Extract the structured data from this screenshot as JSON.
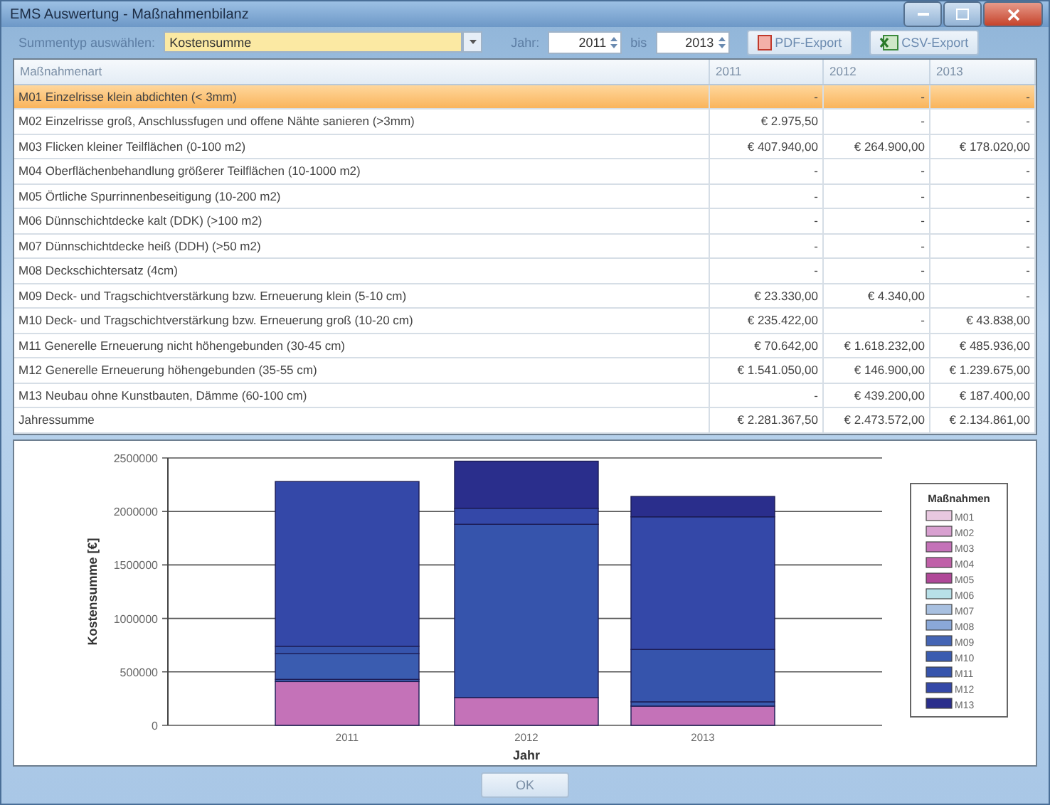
{
  "window": {
    "title": "EMS Auswertung - Maßnahmenbilanz"
  },
  "toolbar": {
    "sum_type_label": "Summentyp auswählen:",
    "sum_type": "Kostensumme",
    "year_label": "Jahr:",
    "year_from": "2011",
    "to_label": "bis",
    "year_to": "2013",
    "buttons": [
      {
        "label": "PDF-Export",
        "kind": "pdf"
      },
      {
        "label": "CSV-Export",
        "kind": "csv"
      }
    ]
  },
  "table": {
    "columns": [
      "Maßnahmenart",
      "2011",
      "2012",
      "2013"
    ],
    "rows": [
      {
        "cells": [
          "M01 Einzelrisse klein abdichten (< 3mm)",
          "-",
          "-",
          "-"
        ],
        "selected": true
      },
      {
        "cells": [
          "M02 Einzelrisse groß, Anschlussfugen und offene Nähte sanieren (>3mm)",
          "€ 2.975,50",
          "-",
          "-"
        ],
        "selected": false
      },
      {
        "cells": [
          "M03 Flicken kleiner Teilflächen (0-100 m2)",
          "€ 407.940,00",
          "€ 264.900,00",
          "€ 178.020,00"
        ],
        "selected": false
      },
      {
        "cells": [
          "M04 Oberflächenbehandlung größerer Teilflächen  (10-1000 m2)",
          "-",
          "-",
          "-"
        ],
        "selected": false
      },
      {
        "cells": [
          "M05 Örtliche Spurrinnenbeseitigung (10-200 m2)",
          "-",
          "-",
          "-"
        ],
        "selected": false
      },
      {
        "cells": [
          "M06 Dünnschichtdecke kalt (DDK) (>100 m2)",
          "-",
          "-",
          "-"
        ],
        "selected": false
      },
      {
        "cells": [
          "M07 Dünnschichtdecke heiß (DDH) (>50 m2)",
          "-",
          "-",
          "-"
        ],
        "selected": false
      },
      {
        "cells": [
          "M08 Deckschichtersatz (4cm)",
          "-",
          "-",
          "-"
        ],
        "selected": false
      },
      {
        "cells": [
          "M09 Deck- und Tragschichtverstärkung bzw. Erneuerung klein (5-10 cm)",
          "€ 23.330,00",
          "€ 4.340,00",
          "-"
        ],
        "selected": false
      },
      {
        "cells": [
          "M10 Deck- und Tragschichtverstärkung bzw. Erneuerung groß (10-20 cm)",
          "€ 235.422,00",
          "-",
          "€ 43.838,00"
        ],
        "selected": false
      },
      {
        "cells": [
          "M11 Generelle Erneuerung nicht höhengebunden (30-45 cm)",
          "€ 70.642,00",
          "€ 1.618.232,00",
          "€ 485.936,00"
        ],
        "selected": false
      },
      {
        "cells": [
          "M12 Generelle Erneuerung höhengebunden (35-55 cm)",
          "€ 1.541.050,00",
          "€ 146.900,00",
          "€ 1.239.675,00"
        ],
        "selected": false
      },
      {
        "cells": [
          "M13 Neubau ohne Kunstbauten, Dämme (60-100 cm)",
          "-",
          "€ 439.200,00",
          "€ 187.400,00"
        ],
        "selected": false
      },
      {
        "cells": [
          "Jahressumme",
          "€ 2.281.367,50",
          "€ 2.473.572,00",
          "€ 2.134.861,00"
        ],
        "selected": false
      }
    ]
  },
  "chart": {
    "chart_data": {
      "type": "bar",
      "stacked": true,
      "xlabel": "Jahr",
      "ylabel": "Kostensumme [€]",
      "grid": true,
      "legend": {
        "title": "Maßnahmen"
      },
      "categories": [
        "2011",
        "2012",
        "2013"
      ],
      "ylim": [
        0,
        2500000
      ],
      "yticks": [
        0,
        500000,
        1000000,
        1500000,
        2000000,
        2500000
      ],
      "series": [
        {
          "name": "M01",
          "color": "#e8c8e0",
          "values": [
            0,
            0,
            0
          ]
        },
        {
          "name": "M02",
          "color": "#d8a0d0",
          "values": [
            0,
            0,
            0
          ]
        },
        {
          "name": "M03",
          "color": "#c472b8",
          "values": [
            410000,
            260000,
            180000
          ]
        },
        {
          "name": "M04",
          "color": "#c060a8",
          "values": [
            0,
            0,
            0
          ]
        },
        {
          "name": "M05",
          "color": "#b04898",
          "values": [
            0,
            0,
            0
          ]
        },
        {
          "name": "M06",
          "color": "#b8e0e8",
          "values": [
            0,
            0,
            0
          ]
        },
        {
          "name": "M07",
          "color": "#a8c0e0",
          "values": [
            0,
            0,
            0
          ]
        },
        {
          "name": "M08",
          "color": "#8aa8d8",
          "values": [
            0,
            0,
            0
          ]
        },
        {
          "name": "M09",
          "color": "#4464b4",
          "values": [
            20000,
            0,
            0
          ]
        },
        {
          "name": "M10",
          "color": "#3a5cb0",
          "values": [
            240000,
            0,
            40000
          ]
        },
        {
          "name": "M11",
          "color": "#3654ac",
          "values": [
            70000,
            1620000,
            490000
          ]
        },
        {
          "name": "M12",
          "color": "#3448a8",
          "values": [
            1540000,
            150000,
            1240000
          ]
        },
        {
          "name": "M13",
          "color": "#2a2e8c",
          "values": [
            0,
            440000,
            190000
          ]
        }
      ]
    }
  },
  "ok_button": "OK"
}
